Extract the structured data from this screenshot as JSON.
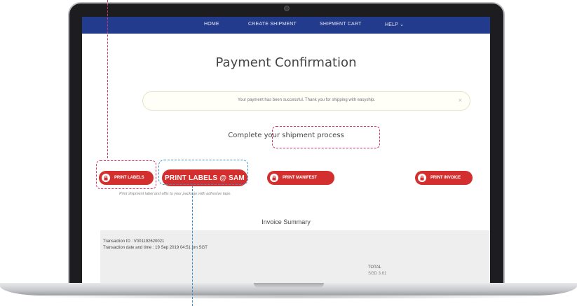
{
  "nav": {
    "items": [
      "HOME",
      "CREATE SHIPMENT",
      "SHIPMENT CART",
      "HELP ⌄"
    ]
  },
  "page": {
    "title": "Payment Confirmation",
    "alert_text": "Your payment has been successful. Thank you for shipping with easyship.",
    "alert_close": "×",
    "subtitle": "Complete your shipment process"
  },
  "actions": {
    "print_labels": "PRINT LABELS",
    "print_labels_sam": "PRINT LABELS @ SAM",
    "print_manifest": "PRINT MANIFEST",
    "print_invoice": "PRINT INVOICE",
    "helper_text": "Print shipment label and affix to your package with adhesive tape."
  },
  "invoice": {
    "title": "Invoice Summary",
    "transaction_id": "Transaction ID : V001192620021",
    "transaction_datetime": "Transaction date and time : 19 Sep 2019 04:51 pm SGT",
    "total_label": "TOTAL",
    "total_sub": "SGD 3.61"
  },
  "colors": {
    "nav_bg": "#233b8c",
    "button_red": "#d32f2f",
    "annotation_pink": "#d6336c",
    "annotation_blue": "#2f8fd0"
  },
  "icons": {
    "button_icon": "lock-icon",
    "close": "close-icon"
  }
}
